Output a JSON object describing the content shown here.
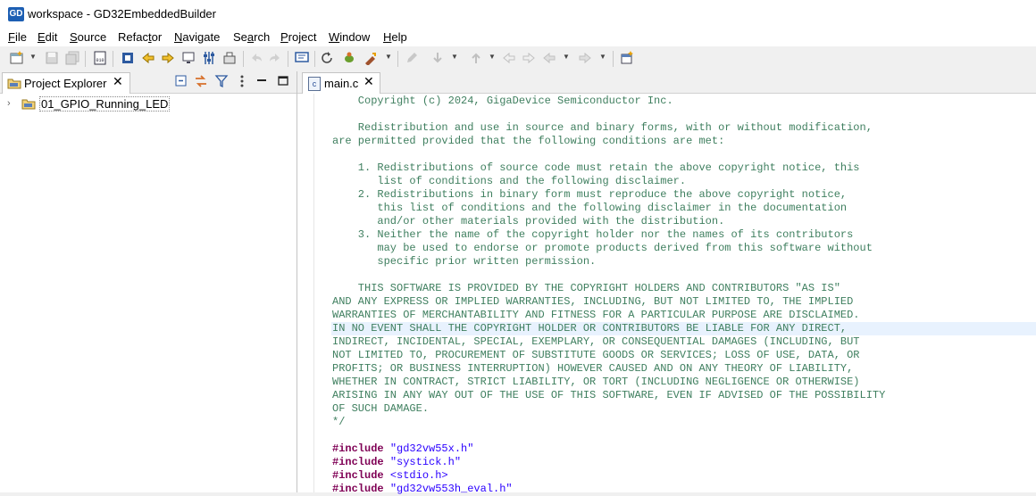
{
  "window": {
    "title": "workspace - GD32EmbeddedBuilder",
    "logo_text": "GD"
  },
  "menubar": [
    {
      "mn": "F",
      "rest": "ile"
    },
    {
      "mn": "E",
      "rest": "dit"
    },
    {
      "mn": "S",
      "rest": "ource"
    },
    {
      "pre": "Refac",
      "mn": "t",
      "rest": "or"
    },
    {
      "mn": "N",
      "rest": "avigate"
    },
    {
      "pre": "Se",
      "mn": "a",
      "rest": "rch"
    },
    {
      "mn": "P",
      "rest": "roject"
    },
    {
      "mn": "W",
      "rest": "indow"
    },
    {
      "mn": "H",
      "rest": "elp"
    }
  ],
  "explorer": {
    "tab_label": "Project Explorer",
    "close_glyph": "✕",
    "project_name": "01_GPIO_Running_LED",
    "expand_glyph": "›"
  },
  "editor": {
    "tab_label": "main.c",
    "tab_icon_text": "c",
    "close_glyph": "✕",
    "lines": [
      "    Copyright (c) 2024, GigaDevice Semiconductor Inc.",
      "",
      "    Redistribution and use in source and binary forms, with or without modification,",
      "are permitted provided that the following conditions are met:",
      "",
      "    1. Redistributions of source code must retain the above copyright notice, this",
      "       list of conditions and the following disclaimer.",
      "    2. Redistributions in binary form must reproduce the above copyright notice,",
      "       this list of conditions and the following disclaimer in the documentation",
      "       and/or other materials provided with the distribution.",
      "    3. Neither the name of the copyright holder nor the names of its contributors",
      "       may be used to endorse or promote products derived from this software without",
      "       specific prior written permission.",
      "",
      "    THIS SOFTWARE IS PROVIDED BY THE COPYRIGHT HOLDERS AND CONTRIBUTORS \"AS IS\"",
      "AND ANY EXPRESS OR IMPLIED WARRANTIES, INCLUDING, BUT NOT LIMITED TO, THE IMPLIED",
      "WARRANTIES OF MERCHANTABILITY AND FITNESS FOR A PARTICULAR PURPOSE ARE DISCLAIMED.",
      "IN NO EVENT SHALL THE COPYRIGHT HOLDER OR CONTRIBUTORS BE LIABLE FOR ANY DIRECT,",
      "INDIRECT, INCIDENTAL, SPECIAL, EXEMPLARY, OR CONSEQUENTIAL DAMAGES (INCLUDING, BUT",
      "NOT LIMITED TO, PROCUREMENT OF SUBSTITUTE GOODS OR SERVICES; LOSS OF USE, DATA, OR",
      "PROFITS; OR BUSINESS INTERRUPTION) HOWEVER CAUSED AND ON ANY THEORY OF LIABILITY,",
      "WHETHER IN CONTRACT, STRICT LIABILITY, OR TORT (INCLUDING NEGLIGENCE OR OTHERWISE)",
      "ARISING IN ANY WAY OUT OF THE USE OF THIS SOFTWARE, EVEN IF ADVISED OF THE POSSIBILITY",
      "OF SUCH DAMAGE.",
      "*/",
      ""
    ],
    "highlighted_line": 17,
    "includes": [
      {
        "kw": "#include",
        "arg": "\"gd32vw55x.h\""
      },
      {
        "kw": "#include",
        "arg": "\"systick.h\""
      },
      {
        "kw": "#include",
        "arg": "<stdio.h>"
      },
      {
        "kw": "#include",
        "arg": "\"gd32vw553h_eval.h\""
      }
    ]
  },
  "colors": {
    "comment": "#3f7f5f",
    "keyword": "#7f0055",
    "string": "#2a00ff",
    "highlight": "#e8f2fe",
    "logo": "#1d5fb3"
  }
}
